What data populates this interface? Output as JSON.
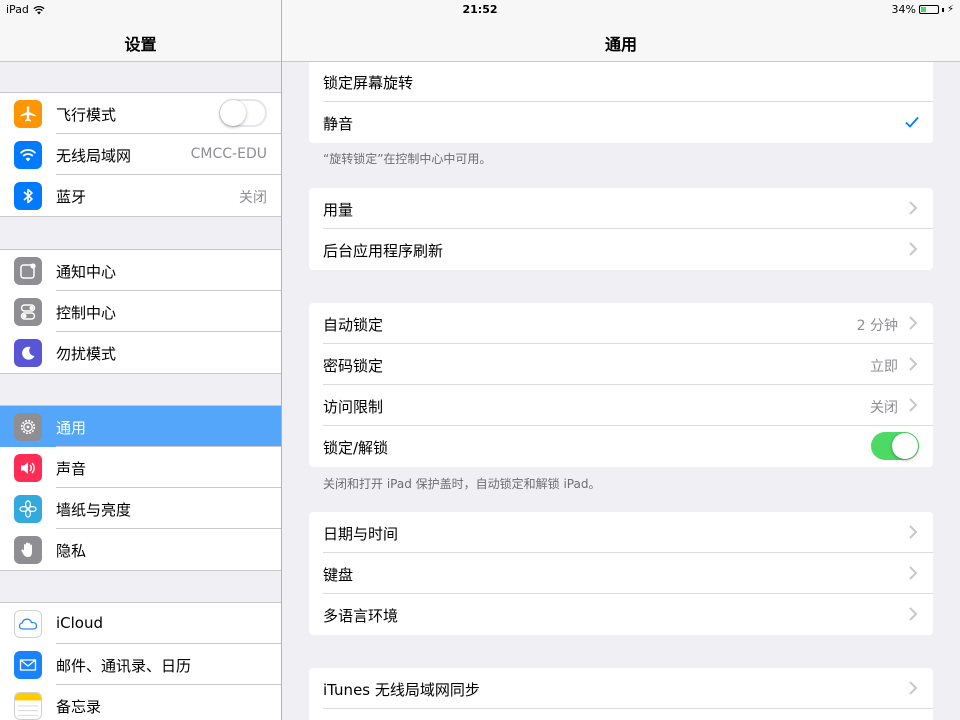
{
  "status_bar": {
    "device": "iPad",
    "time": "21:52",
    "battery": "34%",
    "battery_level": 0.34
  },
  "master": {
    "title": "设置",
    "groups": [
      [
        {
          "label": "飞行模式",
          "icon": "airplane-icon",
          "color": "#ff9500",
          "toggle": false
        },
        {
          "label": "无线局域网",
          "icon": "wifi-icon",
          "color": "#007aff",
          "value": "CMCC-EDU"
        },
        {
          "label": "蓝牙",
          "icon": "bluetooth-icon",
          "color": "#007aff",
          "value": "关闭"
        }
      ],
      [
        {
          "label": "通知中心",
          "icon": "notification-center-icon",
          "color": "#8e8e93"
        },
        {
          "label": "控制中心",
          "icon": "control-center-icon",
          "color": "#8e8e93"
        },
        {
          "label": "勿扰模式",
          "icon": "moon-icon",
          "color": "#5856d6"
        }
      ],
      [
        {
          "label": "通用",
          "icon": "gear-icon",
          "color": "#8e8e93",
          "selected": true
        },
        {
          "label": "声音",
          "icon": "speaker-icon",
          "color": "#ff2d55"
        },
        {
          "label": "墙纸与亮度",
          "icon": "flower-icon",
          "color": "#34aadc"
        },
        {
          "label": "隐私",
          "icon": "hand-icon",
          "color": "#8e8e93"
        }
      ],
      [
        {
          "label": "iCloud",
          "icon": "cloud-icon",
          "color": "#ffffff"
        },
        {
          "label": "邮件、通讯录、日历",
          "icon": "mail-icon",
          "color": "#1a82fb"
        },
        {
          "label": "备忘录",
          "icon": "notes-icon",
          "color": "#ffcc00"
        }
      ]
    ]
  },
  "detail": {
    "title": "通用",
    "rotation": {
      "lock_label": "锁定屏幕旋转",
      "mute_label": "静音",
      "mute_checked": true,
      "footnote": "“旋转锁定”在控制中心中可用。"
    },
    "usage": {
      "usage_label": "用量",
      "refresh_label": "后台应用程序刷新"
    },
    "lock": {
      "auto_lock_label": "自动锁定",
      "auto_lock_value": "2 分钟",
      "passcode_label": "密码锁定",
      "passcode_value": "立即",
      "restrictions_label": "访问限制",
      "restrictions_value": "关闭",
      "lock_unlock_label": "锁定/解锁",
      "lock_unlock_on": true,
      "footnote": "关闭和打开 iPad 保护盖时，自动锁定和解锁 iPad。"
    },
    "datetime": {
      "datetime_label": "日期与时间",
      "keyboard_label": "键盘",
      "language_label": "多语言环境"
    },
    "itunes": {
      "itunes_label": "iTunes 无线局域网同步"
    }
  }
}
